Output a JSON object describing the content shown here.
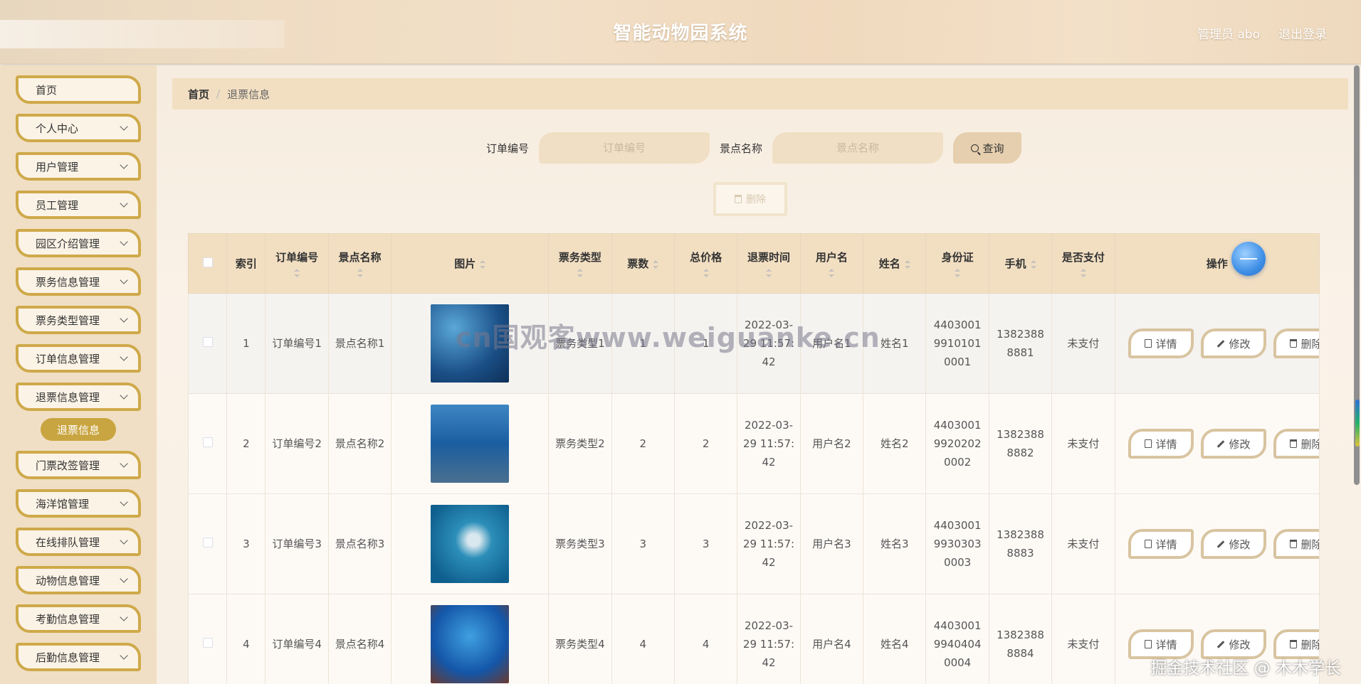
{
  "header": {
    "title": "智能动物园系统",
    "admin": "管理员 abo",
    "logout": "退出登录"
  },
  "sidebar": {
    "items": [
      {
        "label": "首页",
        "has_children": false
      },
      {
        "label": "个人中心",
        "has_children": true
      },
      {
        "label": "用户管理",
        "has_children": true
      },
      {
        "label": "员工管理",
        "has_children": true
      },
      {
        "label": "园区介绍管理",
        "has_children": true
      },
      {
        "label": "票务信息管理",
        "has_children": true
      },
      {
        "label": "票务类型管理",
        "has_children": true
      },
      {
        "label": "订单信息管理",
        "has_children": true
      },
      {
        "label": "退票信息管理",
        "has_children": true
      },
      {
        "label": "门票改签管理",
        "has_children": true
      },
      {
        "label": "海洋馆管理",
        "has_children": true
      },
      {
        "label": "在线排队管理",
        "has_children": true
      },
      {
        "label": "动物信息管理",
        "has_children": true
      },
      {
        "label": "考勤信息管理",
        "has_children": true
      },
      {
        "label": "后勤信息管理",
        "has_children": true
      }
    ],
    "active_sub": "退票信息"
  },
  "breadcrumb": {
    "home": "首页",
    "separator": "/",
    "current": "退票信息"
  },
  "search": {
    "order_label": "订单编号",
    "order_placeholder": "订单编号",
    "spot_label": "景点名称",
    "spot_placeholder": "景点名称",
    "query_button": "查询"
  },
  "toolbar": {
    "delete_button": "删除"
  },
  "table": {
    "headers": {
      "index": "索引",
      "order_no": "订单编号",
      "spot_name": "景点名称",
      "image": "图片",
      "ticket_type": "票务类型",
      "ticket_count": "票数",
      "total_price": "总价格",
      "refund_time": "退票时间",
      "username": "用户名",
      "name": "姓名",
      "id_card": "身份证",
      "phone": "手机",
      "paid": "是否支付",
      "ops": "操作"
    },
    "rows": [
      {
        "index": "1",
        "order_no": "订单编号1",
        "spot_name": "景点名称1",
        "ticket_type": "票务类型1",
        "ticket_count": "1",
        "total_price": "1",
        "refund_time": "2022-03-29 11:57:42",
        "username": "用户名1",
        "name": "姓名1",
        "id_card": "440300199101010001",
        "phone": "13823888881",
        "paid": "未支付"
      },
      {
        "index": "2",
        "order_no": "订单编号2",
        "spot_name": "景点名称2",
        "ticket_type": "票务类型2",
        "ticket_count": "2",
        "total_price": "2",
        "refund_time": "2022-03-29 11:57:42",
        "username": "用户名2",
        "name": "姓名2",
        "id_card": "440300199202020002",
        "phone": "13823888882",
        "paid": "未支付"
      },
      {
        "index": "3",
        "order_no": "订单编号3",
        "spot_name": "景点名称3",
        "ticket_type": "票务类型3",
        "ticket_count": "3",
        "total_price": "3",
        "refund_time": "2022-03-29 11:57:42",
        "username": "用户名3",
        "name": "姓名3",
        "id_card": "440300199303030003",
        "phone": "13823888883",
        "paid": "未支付"
      },
      {
        "index": "4",
        "order_no": "订单编号4",
        "spot_name": "景点名称4",
        "ticket_type": "票务类型4",
        "ticket_count": "4",
        "total_price": "4",
        "refund_time": "2022-03-29 11:57:42",
        "username": "用户名4",
        "name": "姓名4",
        "id_card": "440300199404040004",
        "phone": "13823888884",
        "paid": "未支付"
      }
    ],
    "row_actions": {
      "detail": "详情",
      "edit": "修改",
      "delete": "删除"
    }
  },
  "overlays": {
    "watermark": "cn国观客www.weiguanke.cn",
    "credit": "掘金技术社区 @ 木木学长"
  }
}
